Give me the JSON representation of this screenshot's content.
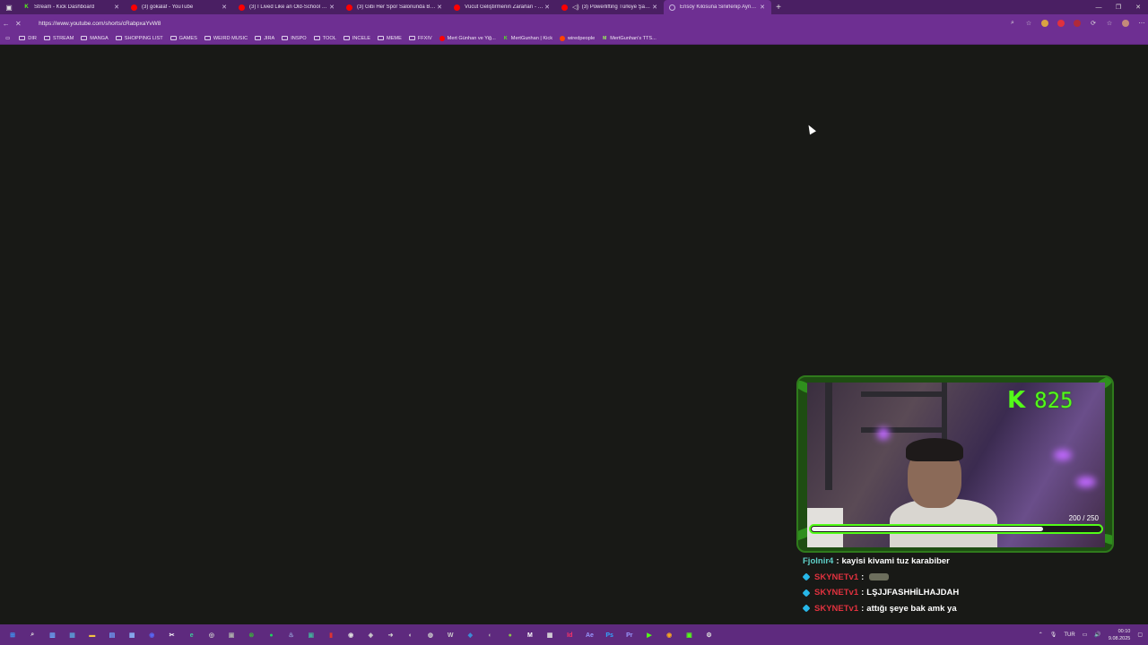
{
  "browser": {
    "tabs": [
      {
        "title": "Stream - Kick Dashboard",
        "icon": "kick",
        "active": false
      },
      {
        "title": "(3) gokalaf - YouTube",
        "icon": "youtube",
        "active": false
      },
      {
        "title": "(3) I Lived Like an Old-School Bo...",
        "icon": "youtube",
        "active": false
      },
      {
        "title": "(3) Gibi Her Spor Salonunda Bulu...",
        "icon": "youtube",
        "active": false
      },
      {
        "title": "Vücut Geliştirmenin Zararları - Yo...",
        "icon": "youtube",
        "active": false
      },
      {
        "title": "(3) Powerlifting Türkiye Şam...",
        "icon": "youtube",
        "active": false
      },
      {
        "title": "Ensoy Kilosuna Sinirlenip Aynayı...",
        "icon": "loading",
        "active": true
      }
    ],
    "new_tab": "+",
    "url": "https://www.youtube.com/shorts/cRabpxaYvW8",
    "bookmarks": [
      {
        "label": "DIR",
        "type": "folder"
      },
      {
        "label": "STREAM",
        "type": "folder"
      },
      {
        "label": "MANGA",
        "type": "folder"
      },
      {
        "label": "SHOPPING LIST",
        "type": "folder"
      },
      {
        "label": "GAMES",
        "type": "folder"
      },
      {
        "label": "WEIRD MUSIC",
        "type": "folder"
      },
      {
        "label": "JIRA",
        "type": "folder"
      },
      {
        "label": "INSPO",
        "type": "folder"
      },
      {
        "label": "TOOL",
        "type": "folder"
      },
      {
        "label": "INCELE",
        "type": "folder"
      },
      {
        "label": "MEME",
        "type": "folder"
      },
      {
        "label": "FFXIV",
        "type": "folder"
      },
      {
        "label": "Mert Günhan ve Yiğ...",
        "type": "youtube"
      },
      {
        "label": "MertGunhan | Kick",
        "type": "kick"
      },
      {
        "label": "wiredpeople",
        "type": "reddit"
      },
      {
        "label": "MertGunhan's TTS...",
        "type": "tts"
      }
    ]
  },
  "overlay": {
    "sub_count": "825",
    "goal_text": "200 / 250",
    "goal_fraction": 0.8,
    "chat": [
      {
        "user": "Fjolnir4",
        "user_color": "#5fd1c9",
        "badge": false,
        "message": "kayisi kivami tuz karabiber",
        "emote": false
      },
      {
        "user": "SKYNETv1",
        "user_color": "#e0313e",
        "badge": true,
        "message": "",
        "emote": true
      },
      {
        "user": "SKYNETv1",
        "user_color": "#e0313e",
        "badge": true,
        "message": "LŞJJFASHHİLHAJDAH",
        "emote": false
      },
      {
        "user": "SKYNETv1",
        "user_color": "#e0313e",
        "badge": true,
        "message": "attığı şeye bak amk ya",
        "emote": false
      }
    ],
    "separator": ":"
  },
  "taskbar": {
    "language": "TUR",
    "time": "00:10",
    "date": "9.08.2025"
  },
  "colors": {
    "chrome_dark": "#4a1f63",
    "chrome": "#6e2f92",
    "kick_green": "#53fc18",
    "page_bg": "#181916"
  }
}
